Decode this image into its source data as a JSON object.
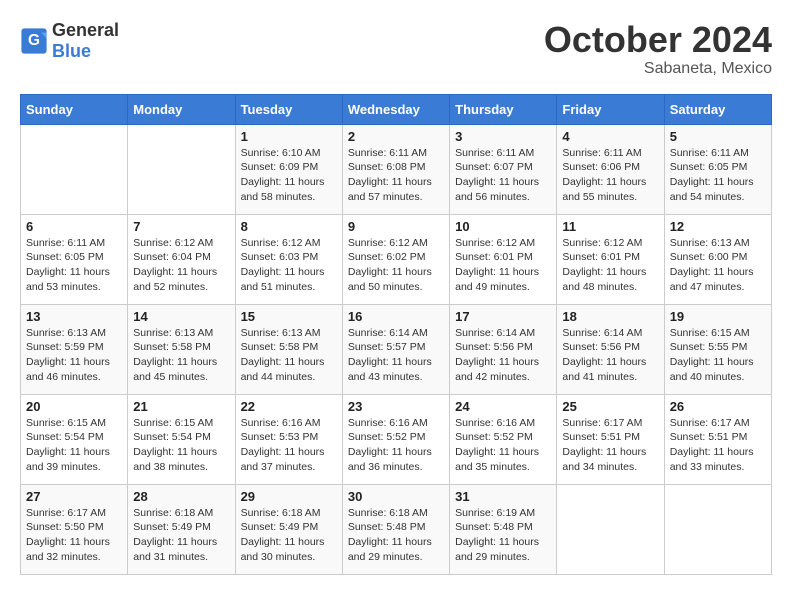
{
  "header": {
    "logo_general": "General",
    "logo_blue": "Blue",
    "month_year": "October 2024",
    "location": "Sabaneta, Mexico"
  },
  "weekdays": [
    "Sunday",
    "Monday",
    "Tuesday",
    "Wednesday",
    "Thursday",
    "Friday",
    "Saturday"
  ],
  "weeks": [
    [
      {
        "day": "",
        "sunrise": "",
        "sunset": "",
        "daylight": ""
      },
      {
        "day": "",
        "sunrise": "",
        "sunset": "",
        "daylight": ""
      },
      {
        "day": "1",
        "sunrise": "Sunrise: 6:10 AM",
        "sunset": "Sunset: 6:09 PM",
        "daylight": "Daylight: 11 hours and 58 minutes."
      },
      {
        "day": "2",
        "sunrise": "Sunrise: 6:11 AM",
        "sunset": "Sunset: 6:08 PM",
        "daylight": "Daylight: 11 hours and 57 minutes."
      },
      {
        "day": "3",
        "sunrise": "Sunrise: 6:11 AM",
        "sunset": "Sunset: 6:07 PM",
        "daylight": "Daylight: 11 hours and 56 minutes."
      },
      {
        "day": "4",
        "sunrise": "Sunrise: 6:11 AM",
        "sunset": "Sunset: 6:06 PM",
        "daylight": "Daylight: 11 hours and 55 minutes."
      },
      {
        "day": "5",
        "sunrise": "Sunrise: 6:11 AM",
        "sunset": "Sunset: 6:05 PM",
        "daylight": "Daylight: 11 hours and 54 minutes."
      }
    ],
    [
      {
        "day": "6",
        "sunrise": "Sunrise: 6:11 AM",
        "sunset": "Sunset: 6:05 PM",
        "daylight": "Daylight: 11 hours and 53 minutes."
      },
      {
        "day": "7",
        "sunrise": "Sunrise: 6:12 AM",
        "sunset": "Sunset: 6:04 PM",
        "daylight": "Daylight: 11 hours and 52 minutes."
      },
      {
        "day": "8",
        "sunrise": "Sunrise: 6:12 AM",
        "sunset": "Sunset: 6:03 PM",
        "daylight": "Daylight: 11 hours and 51 minutes."
      },
      {
        "day": "9",
        "sunrise": "Sunrise: 6:12 AM",
        "sunset": "Sunset: 6:02 PM",
        "daylight": "Daylight: 11 hours and 50 minutes."
      },
      {
        "day": "10",
        "sunrise": "Sunrise: 6:12 AM",
        "sunset": "Sunset: 6:01 PM",
        "daylight": "Daylight: 11 hours and 49 minutes."
      },
      {
        "day": "11",
        "sunrise": "Sunrise: 6:12 AM",
        "sunset": "Sunset: 6:01 PM",
        "daylight": "Daylight: 11 hours and 48 minutes."
      },
      {
        "day": "12",
        "sunrise": "Sunrise: 6:13 AM",
        "sunset": "Sunset: 6:00 PM",
        "daylight": "Daylight: 11 hours and 47 minutes."
      }
    ],
    [
      {
        "day": "13",
        "sunrise": "Sunrise: 6:13 AM",
        "sunset": "Sunset: 5:59 PM",
        "daylight": "Daylight: 11 hours and 46 minutes."
      },
      {
        "day": "14",
        "sunrise": "Sunrise: 6:13 AM",
        "sunset": "Sunset: 5:58 PM",
        "daylight": "Daylight: 11 hours and 45 minutes."
      },
      {
        "day": "15",
        "sunrise": "Sunrise: 6:13 AM",
        "sunset": "Sunset: 5:58 PM",
        "daylight": "Daylight: 11 hours and 44 minutes."
      },
      {
        "day": "16",
        "sunrise": "Sunrise: 6:14 AM",
        "sunset": "Sunset: 5:57 PM",
        "daylight": "Daylight: 11 hours and 43 minutes."
      },
      {
        "day": "17",
        "sunrise": "Sunrise: 6:14 AM",
        "sunset": "Sunset: 5:56 PM",
        "daylight": "Daylight: 11 hours and 42 minutes."
      },
      {
        "day": "18",
        "sunrise": "Sunrise: 6:14 AM",
        "sunset": "Sunset: 5:56 PM",
        "daylight": "Daylight: 11 hours and 41 minutes."
      },
      {
        "day": "19",
        "sunrise": "Sunrise: 6:15 AM",
        "sunset": "Sunset: 5:55 PM",
        "daylight": "Daylight: 11 hours and 40 minutes."
      }
    ],
    [
      {
        "day": "20",
        "sunrise": "Sunrise: 6:15 AM",
        "sunset": "Sunset: 5:54 PM",
        "daylight": "Daylight: 11 hours and 39 minutes."
      },
      {
        "day": "21",
        "sunrise": "Sunrise: 6:15 AM",
        "sunset": "Sunset: 5:54 PM",
        "daylight": "Daylight: 11 hours and 38 minutes."
      },
      {
        "day": "22",
        "sunrise": "Sunrise: 6:16 AM",
        "sunset": "Sunset: 5:53 PM",
        "daylight": "Daylight: 11 hours and 37 minutes."
      },
      {
        "day": "23",
        "sunrise": "Sunrise: 6:16 AM",
        "sunset": "Sunset: 5:52 PM",
        "daylight": "Daylight: 11 hours and 36 minutes."
      },
      {
        "day": "24",
        "sunrise": "Sunrise: 6:16 AM",
        "sunset": "Sunset: 5:52 PM",
        "daylight": "Daylight: 11 hours and 35 minutes."
      },
      {
        "day": "25",
        "sunrise": "Sunrise: 6:17 AM",
        "sunset": "Sunset: 5:51 PM",
        "daylight": "Daylight: 11 hours and 34 minutes."
      },
      {
        "day": "26",
        "sunrise": "Sunrise: 6:17 AM",
        "sunset": "Sunset: 5:51 PM",
        "daylight": "Daylight: 11 hours and 33 minutes."
      }
    ],
    [
      {
        "day": "27",
        "sunrise": "Sunrise: 6:17 AM",
        "sunset": "Sunset: 5:50 PM",
        "daylight": "Daylight: 11 hours and 32 minutes."
      },
      {
        "day": "28",
        "sunrise": "Sunrise: 6:18 AM",
        "sunset": "Sunset: 5:49 PM",
        "daylight": "Daylight: 11 hours and 31 minutes."
      },
      {
        "day": "29",
        "sunrise": "Sunrise: 6:18 AM",
        "sunset": "Sunset: 5:49 PM",
        "daylight": "Daylight: 11 hours and 30 minutes."
      },
      {
        "day": "30",
        "sunrise": "Sunrise: 6:18 AM",
        "sunset": "Sunset: 5:48 PM",
        "daylight": "Daylight: 11 hours and 29 minutes."
      },
      {
        "day": "31",
        "sunrise": "Sunrise: 6:19 AM",
        "sunset": "Sunset: 5:48 PM",
        "daylight": "Daylight: 11 hours and 29 minutes."
      },
      {
        "day": "",
        "sunrise": "",
        "sunset": "",
        "daylight": ""
      },
      {
        "day": "",
        "sunrise": "",
        "sunset": "",
        "daylight": ""
      }
    ]
  ]
}
